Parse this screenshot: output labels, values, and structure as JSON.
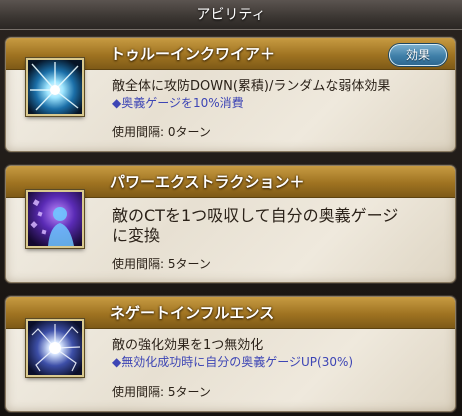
{
  "header": {
    "title": "アビリティ"
  },
  "abilities": [
    {
      "name": "トゥルーインクワイア＋",
      "effect_button": "効果",
      "description": "敵全体に攻防DOWN(累積)/ランダムな弱体効果",
      "note": "◆奥義ゲージを10%消費",
      "interval": "使用間隔: 0ターン",
      "icon": "light-burst-icon"
    },
    {
      "name": "パワーエクストラクション＋",
      "description_line1": "敵のCTを1つ吸収して自分の奥義ゲージ",
      "description_line2": "に変換",
      "interval": "使用間隔: 5ターン",
      "icon": "silhouette-drain-icon"
    },
    {
      "name": "ネゲートインフルエンス",
      "description": "敵の強化効果を1つ無効化",
      "note": "◆無効化成功時に自分の奥義ゲージUP(30%)",
      "interval": "使用間隔: 5ターン",
      "icon": "shatter-icon"
    }
  ],
  "colors": {
    "title_band": "#a57a28",
    "note_blue": "#3d45b5",
    "effect_button": "#3f7fa8"
  }
}
